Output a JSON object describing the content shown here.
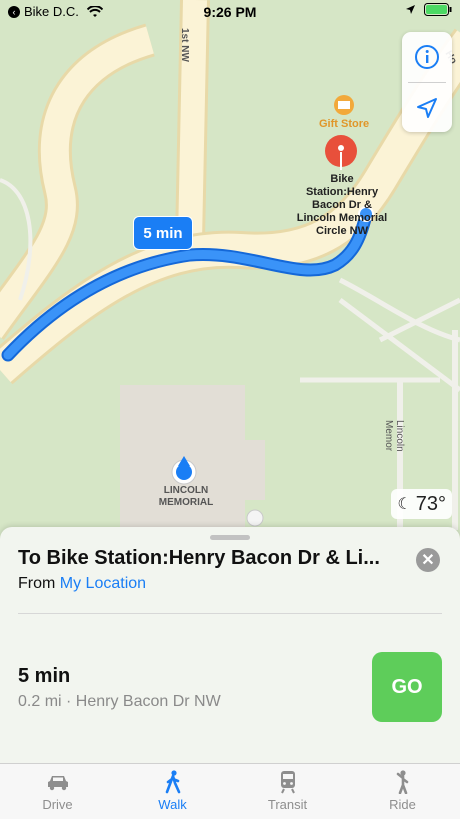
{
  "status_bar": {
    "back_app": "Bike D.C.",
    "time": "9:26 PM"
  },
  "map": {
    "street_vertical": "1st NW",
    "street_right_top": "Ho",
    "street_right_side": "Lincoln Memor",
    "gift_store": "Gift Store",
    "destination_pin_label": [
      "Bike",
      "Station:Henry",
      "Bacon Dr &",
      "Lincoln Memorial",
      "Circle NW"
    ],
    "landmark_label": [
      "LINCOLN",
      "MEMORIAL"
    ],
    "route_time": "5 min",
    "weather_temp": "73°",
    "route_color": "#1a7ef5"
  },
  "sheet": {
    "destination": "To Bike Station:Henry Bacon Dr & Li...",
    "from_prefix": "From",
    "from_location": "My Location",
    "duration": "5 min",
    "route_details": "0.2 mi · Henry Bacon Dr NW",
    "go_label": "GO",
    "go_color": "#5ecd5a"
  },
  "tabs": [
    {
      "label": "Drive",
      "icon": "car-icon"
    },
    {
      "label": "Walk",
      "icon": "walk-icon",
      "active": true
    },
    {
      "label": "Transit",
      "icon": "train-icon"
    },
    {
      "label": "Ride",
      "icon": "ride-icon"
    }
  ]
}
